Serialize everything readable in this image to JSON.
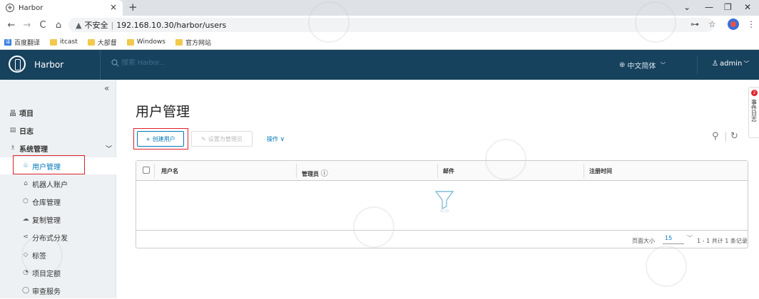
{
  "browser": {
    "tab_title": "Harbor",
    "tab_close": "×",
    "new_tab": "+",
    "insecure_label": "不安全",
    "url": "192.168.10.30/harbor/users",
    "bookmarks": [
      {
        "label": "百度翻译",
        "icon": "translate-icon"
      },
      {
        "label": "itcast",
        "icon": "folder-icon"
      },
      {
        "label": "大部督",
        "icon": "folder-icon"
      },
      {
        "label": "Windows",
        "icon": "folder-icon"
      },
      {
        "label": "官方网站",
        "icon": "folder-icon"
      }
    ]
  },
  "header": {
    "brand": "Harbor",
    "search_placeholder": "搜索 Harbor...",
    "language": "中文简体",
    "user": "admin"
  },
  "sidebar": {
    "items": [
      {
        "label": "项目",
        "icon": "project-icon"
      },
      {
        "label": "日志",
        "icon": "log-icon"
      },
      {
        "label": "系统管理",
        "icon": "admin-icon"
      },
      {
        "label": "用户管理",
        "icon": "users-icon"
      },
      {
        "label": "机器人账户",
        "icon": "robot-icon"
      },
      {
        "label": "仓库管理",
        "icon": "registry-icon"
      },
      {
        "label": "复制管理",
        "icon": "replication-icon"
      },
      {
        "label": "分布式分发",
        "icon": "distribution-icon"
      },
      {
        "label": "标签",
        "icon": "tag-icon"
      },
      {
        "label": "项目定额",
        "icon": "quota-icon"
      },
      {
        "label": "审查服务",
        "icon": "scan-icon"
      }
    ]
  },
  "main": {
    "title": "用户管理",
    "create_user": "+ 创建用户",
    "set_admin": "设置为管理员",
    "actions": "操作",
    "columns": [
      "用户名",
      "管理员",
      "邮件",
      "注册时间"
    ],
    "page_size_label": "页面大小",
    "page_size": "15",
    "total": "1 - 1 共计 1 条记录"
  },
  "side_widget": {
    "label": "事件日志",
    "badge": "2"
  }
}
